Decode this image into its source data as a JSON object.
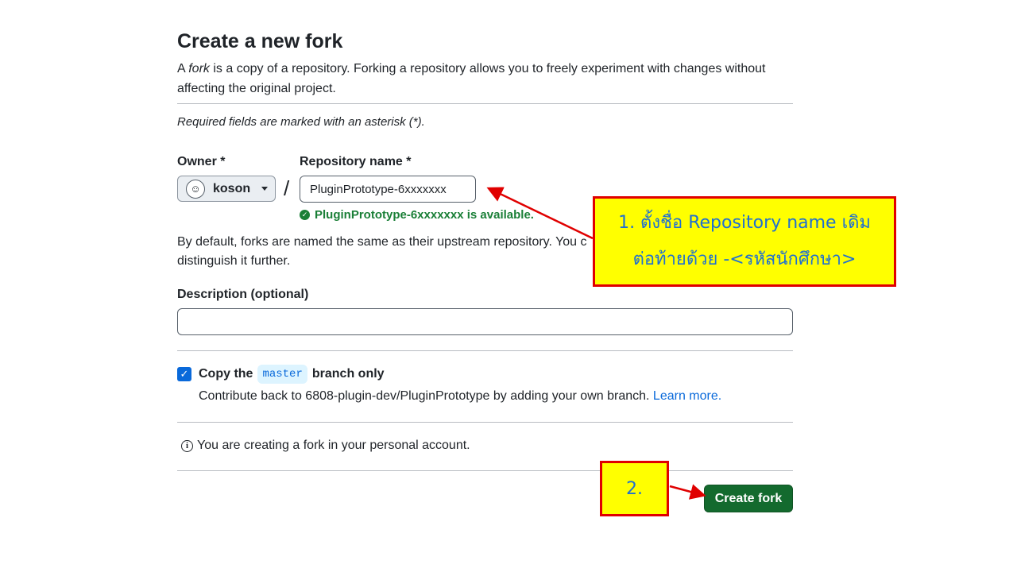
{
  "page": {
    "title": "Create a new fork",
    "intro_prefix": "A ",
    "intro_fork_word": "fork",
    "intro_rest": " is a copy of a repository. Forking a repository allows you to freely experiment with changes without affecting the original project.",
    "required_note": "Required fields are marked with an asterisk (*)."
  },
  "owner": {
    "label": "Owner *",
    "value": "koson"
  },
  "separator": "/",
  "repo": {
    "label": "Repository name *",
    "value": "PluginPrototype-6xxxxxxx",
    "availability": "PluginPrototype-6xxxxxxx is available."
  },
  "hint": {
    "line1": "By default, forks are named the same as their upstream repository. You c",
    "line2": "distinguish it further."
  },
  "description": {
    "label": "Description (optional)",
    "value": ""
  },
  "copy_branch": {
    "checked": true,
    "prefix": "Copy the",
    "branch": "master",
    "suffix": "branch only",
    "contrib_text": "Contribute back to 6808-plugin-dev/PluginPrototype by adding your own branch.",
    "learn_more": "Learn more."
  },
  "info": {
    "text": "You are creating a fork in your personal account."
  },
  "create_button": {
    "label": "Create fork"
  },
  "callouts": {
    "step1_line1": "1. ตั้งชื่อ Repository name เดิม",
    "step1_line2": "ต่อท้ายด้วย -<รหัสนักศึกษา>",
    "step2": "2."
  },
  "colors": {
    "primary_button": "#136a2e",
    "success": "#1a7f37",
    "link": "#0969da",
    "callout_fill": "#ffff00",
    "callout_border": "#e00000",
    "callout_text": "#1f6fd1"
  },
  "icons": {
    "avatar": "user-avatar-icon",
    "caret": "chevron-down-icon",
    "check": "check-circle-icon",
    "info": "info-icon"
  }
}
